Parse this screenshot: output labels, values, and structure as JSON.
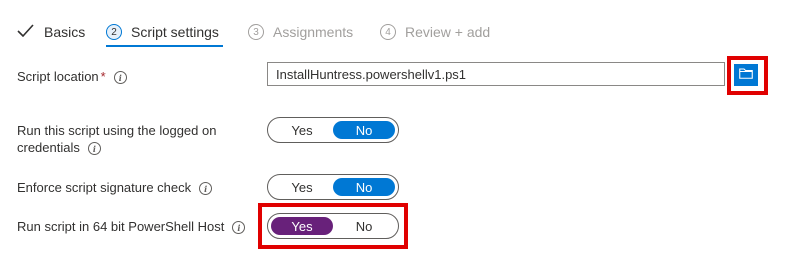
{
  "wizard": {
    "steps": [
      {
        "label": "Basics",
        "state": "done"
      },
      {
        "number": "2",
        "label": "Script settings",
        "state": "current"
      },
      {
        "number": "3",
        "label": "Assignments",
        "state": "disabled"
      },
      {
        "number": "4",
        "label": "Review + add",
        "state": "disabled"
      }
    ]
  },
  "form": {
    "script_location": {
      "label": "Script location",
      "required_mark": "*",
      "value": "InstallHuntress.powershellv1.ps1",
      "browse_icon": "folder-icon"
    },
    "run_as_logged_on": {
      "label_line1": "Run this script using the logged on",
      "label_line2": "credentials",
      "yes": "Yes",
      "no": "No",
      "selected": "No"
    },
    "enforce_signature": {
      "label": "Enforce script signature check",
      "yes": "Yes",
      "no": "No",
      "selected": "No"
    },
    "run_64bit": {
      "label": "Run script in 64 bit PowerShell Host",
      "yes": "Yes",
      "no": "No",
      "selected": "Yes"
    }
  },
  "colors": {
    "accent": "#0078d4",
    "toggle_purple": "#68217a",
    "highlight": "#e00000"
  }
}
